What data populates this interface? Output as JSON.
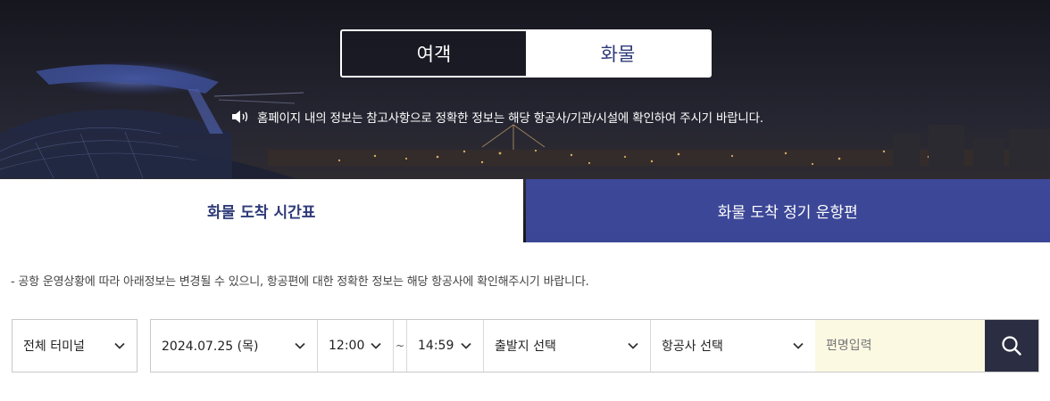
{
  "toggle": {
    "passenger_label": "여객",
    "cargo_label": "화물",
    "selected": "cargo"
  },
  "notice": {
    "icon": "speaker-icon",
    "text": "홈페이지 내의 정보는 참고사항으로 정확한 정보는 해당 항공사/기관/시설에 확인하여 주시기 바랍니다."
  },
  "tabs": [
    {
      "label": "화물 도착 시간표",
      "active": true
    },
    {
      "label": "화물 도착 정기 운항편",
      "active": false
    }
  ],
  "info_text": "-  공항 운영상황에 따라 아래정보는 변경될 수 있으니, 항공편에 대한 정확한 정보는 해당 항공사에 확인해주시기 바랍니다.",
  "filters": {
    "terminal": "전체 터미널",
    "date": "2024.07.25 (목)",
    "time_from": "12:00",
    "time_sep": "~",
    "time_to": "14:59",
    "origin": "출발지 선택",
    "airline": "항공사 선택",
    "flight_placeholder": "편명입력",
    "search_icon": "search-icon"
  },
  "colors": {
    "accent": "#2f3a78",
    "tab_inactive": "#3e4aa0",
    "search_button": "#2b2e42",
    "input_bg": "#fcf9e3"
  }
}
